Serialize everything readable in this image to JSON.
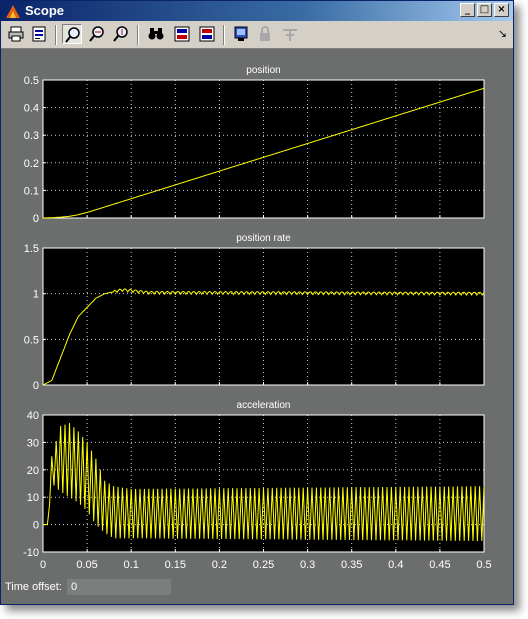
{
  "window": {
    "title": "Scope"
  },
  "toolbar": {
    "buttons": [
      "print-icon",
      "parameters-icon",
      "zoom-icon",
      "zoom-x-icon",
      "zoom-y-icon",
      "autoscale-binoculars-icon",
      "save-axes-icon",
      "restore-axes-icon",
      "floating-scope-icon",
      "lock-icon",
      "signal-selection-icon"
    ],
    "dock_glyph": "↘"
  },
  "status": {
    "time_offset_label": "Time offset:",
    "time_offset_value": "0"
  },
  "colors": {
    "trace": "#ffff00",
    "plot_bg": "#000000",
    "figure_bg": "#6b6e6c",
    "grid": "#ffffff"
  },
  "chart_data": [
    {
      "type": "line",
      "title": "position",
      "xlim": [
        0,
        0.5
      ],
      "ylim": [
        0,
        0.5
      ],
      "xticks": [
        "0",
        "0.05",
        "0.1",
        "0.15",
        "0.2",
        "0.25",
        "0.3",
        "0.35",
        "0.4",
        "0.45",
        "0.5"
      ],
      "yticks": [
        "0",
        "0.1",
        "0.2",
        "0.3",
        "0.4",
        "0.5"
      ],
      "grid": true,
      "series": [
        {
          "x": [
            0,
            0.01,
            0.02,
            0.03,
            0.04,
            0.05,
            0.06,
            0.07,
            0.08,
            0.1,
            0.15,
            0.2,
            0.25,
            0.3,
            0.35,
            0.4,
            0.45,
            0.5
          ],
          "y": [
            0,
            0.001,
            0.003,
            0.006,
            0.012,
            0.02,
            0.03,
            0.04,
            0.05,
            0.07,
            0.12,
            0.17,
            0.22,
            0.27,
            0.32,
            0.37,
            0.42,
            0.47
          ]
        }
      ]
    },
    {
      "type": "line",
      "title": "position rate",
      "xlim": [
        0,
        0.5
      ],
      "ylim": [
        0,
        1.5
      ],
      "xticks": [
        "0",
        "0.05",
        "0.1",
        "0.15",
        "0.2",
        "0.25",
        "0.3",
        "0.35",
        "0.4",
        "0.45",
        "0.5"
      ],
      "yticks": [
        "0",
        "0.5",
        "1",
        "1.5"
      ],
      "grid": true,
      "series": [
        {
          "x": [
            0,
            0.01,
            0.02,
            0.03,
            0.04,
            0.05,
            0.06,
            0.07,
            0.08,
            0.09,
            0.1,
            0.11,
            0.12,
            0.5
          ],
          "y": [
            0,
            0.05,
            0.3,
            0.55,
            0.75,
            0.85,
            0.95,
            1.0,
            1.02,
            1.04,
            1.03,
            1.02,
            1.01,
            1.0
          ],
          "ripple": {
            "amplitude": 0.03,
            "period": 0.006
          }
        }
      ]
    },
    {
      "type": "line",
      "title": "acceleration",
      "xlim": [
        0,
        0.5
      ],
      "ylim": [
        -10,
        40
      ],
      "xticks": [
        "0",
        "0.05",
        "0.1",
        "0.15",
        "0.2",
        "0.25",
        "0.3",
        "0.35",
        "0.4",
        "0.45",
        "0.5"
      ],
      "yticks": [
        "-10",
        "0",
        "10",
        "20",
        "30",
        "40"
      ],
      "grid": true,
      "series": [
        {
          "envelope_x": [
            0,
            0.005,
            0.01,
            0.02,
            0.03,
            0.04,
            0.05,
            0.06,
            0.07,
            0.08,
            0.1,
            0.5
          ],
          "envelope_hi": [
            0,
            0,
            25,
            36,
            37,
            34,
            30,
            24,
            16,
            14,
            13,
            14
          ],
          "envelope_lo": [
            0,
            0,
            15,
            12,
            10,
            8,
            5,
            0,
            -3,
            -5,
            -5,
            -6
          ],
          "oscillation_period": 0.01
        }
      ]
    }
  ]
}
